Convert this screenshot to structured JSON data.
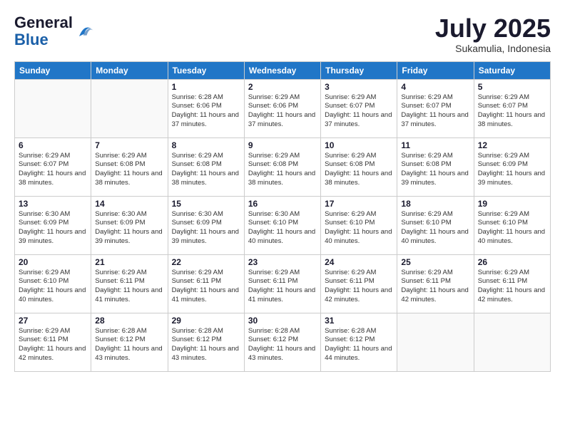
{
  "header": {
    "logo_line1": "General",
    "logo_line2": "Blue",
    "month": "July 2025",
    "location": "Sukamulia, Indonesia"
  },
  "weekdays": [
    "Sunday",
    "Monday",
    "Tuesday",
    "Wednesday",
    "Thursday",
    "Friday",
    "Saturday"
  ],
  "weeks": [
    [
      {
        "day": "",
        "empty": true
      },
      {
        "day": "",
        "empty": true
      },
      {
        "day": "1",
        "sunrise": "6:28 AM",
        "sunset": "6:06 PM",
        "daylight": "11 hours and 37 minutes."
      },
      {
        "day": "2",
        "sunrise": "6:29 AM",
        "sunset": "6:06 PM",
        "daylight": "11 hours and 37 minutes."
      },
      {
        "day": "3",
        "sunrise": "6:29 AM",
        "sunset": "6:07 PM",
        "daylight": "11 hours and 37 minutes."
      },
      {
        "day": "4",
        "sunrise": "6:29 AM",
        "sunset": "6:07 PM",
        "daylight": "11 hours and 37 minutes."
      },
      {
        "day": "5",
        "sunrise": "6:29 AM",
        "sunset": "6:07 PM",
        "daylight": "11 hours and 38 minutes."
      }
    ],
    [
      {
        "day": "6",
        "sunrise": "6:29 AM",
        "sunset": "6:07 PM",
        "daylight": "11 hours and 38 minutes."
      },
      {
        "day": "7",
        "sunrise": "6:29 AM",
        "sunset": "6:08 PM",
        "daylight": "11 hours and 38 minutes."
      },
      {
        "day": "8",
        "sunrise": "6:29 AM",
        "sunset": "6:08 PM",
        "daylight": "11 hours and 38 minutes."
      },
      {
        "day": "9",
        "sunrise": "6:29 AM",
        "sunset": "6:08 PM",
        "daylight": "11 hours and 38 minutes."
      },
      {
        "day": "10",
        "sunrise": "6:29 AM",
        "sunset": "6:08 PM",
        "daylight": "11 hours and 38 minutes."
      },
      {
        "day": "11",
        "sunrise": "6:29 AM",
        "sunset": "6:08 PM",
        "daylight": "11 hours and 39 minutes."
      },
      {
        "day": "12",
        "sunrise": "6:29 AM",
        "sunset": "6:09 PM",
        "daylight": "11 hours and 39 minutes."
      }
    ],
    [
      {
        "day": "13",
        "sunrise": "6:30 AM",
        "sunset": "6:09 PM",
        "daylight": "11 hours and 39 minutes."
      },
      {
        "day": "14",
        "sunrise": "6:30 AM",
        "sunset": "6:09 PM",
        "daylight": "11 hours and 39 minutes."
      },
      {
        "day": "15",
        "sunrise": "6:30 AM",
        "sunset": "6:09 PM",
        "daylight": "11 hours and 39 minutes."
      },
      {
        "day": "16",
        "sunrise": "6:30 AM",
        "sunset": "6:10 PM",
        "daylight": "11 hours and 40 minutes."
      },
      {
        "day": "17",
        "sunrise": "6:29 AM",
        "sunset": "6:10 PM",
        "daylight": "11 hours and 40 minutes."
      },
      {
        "day": "18",
        "sunrise": "6:29 AM",
        "sunset": "6:10 PM",
        "daylight": "11 hours and 40 minutes."
      },
      {
        "day": "19",
        "sunrise": "6:29 AM",
        "sunset": "6:10 PM",
        "daylight": "11 hours and 40 minutes."
      }
    ],
    [
      {
        "day": "20",
        "sunrise": "6:29 AM",
        "sunset": "6:10 PM",
        "daylight": "11 hours and 40 minutes."
      },
      {
        "day": "21",
        "sunrise": "6:29 AM",
        "sunset": "6:11 PM",
        "daylight": "11 hours and 41 minutes."
      },
      {
        "day": "22",
        "sunrise": "6:29 AM",
        "sunset": "6:11 PM",
        "daylight": "11 hours and 41 minutes."
      },
      {
        "day": "23",
        "sunrise": "6:29 AM",
        "sunset": "6:11 PM",
        "daylight": "11 hours and 41 minutes."
      },
      {
        "day": "24",
        "sunrise": "6:29 AM",
        "sunset": "6:11 PM",
        "daylight": "11 hours and 42 minutes."
      },
      {
        "day": "25",
        "sunrise": "6:29 AM",
        "sunset": "6:11 PM",
        "daylight": "11 hours and 42 minutes."
      },
      {
        "day": "26",
        "sunrise": "6:29 AM",
        "sunset": "6:11 PM",
        "daylight": "11 hours and 42 minutes."
      }
    ],
    [
      {
        "day": "27",
        "sunrise": "6:29 AM",
        "sunset": "6:11 PM",
        "daylight": "11 hours and 42 minutes."
      },
      {
        "day": "28",
        "sunrise": "6:28 AM",
        "sunset": "6:12 PM",
        "daylight": "11 hours and 43 minutes."
      },
      {
        "day": "29",
        "sunrise": "6:28 AM",
        "sunset": "6:12 PM",
        "daylight": "11 hours and 43 minutes."
      },
      {
        "day": "30",
        "sunrise": "6:28 AM",
        "sunset": "6:12 PM",
        "daylight": "11 hours and 43 minutes."
      },
      {
        "day": "31",
        "sunrise": "6:28 AM",
        "sunset": "6:12 PM",
        "daylight": "11 hours and 44 minutes."
      },
      {
        "day": "",
        "empty": true
      },
      {
        "day": "",
        "empty": true
      }
    ]
  ],
  "labels": {
    "sunrise": "Sunrise:",
    "sunset": "Sunset:",
    "daylight": "Daylight:"
  }
}
